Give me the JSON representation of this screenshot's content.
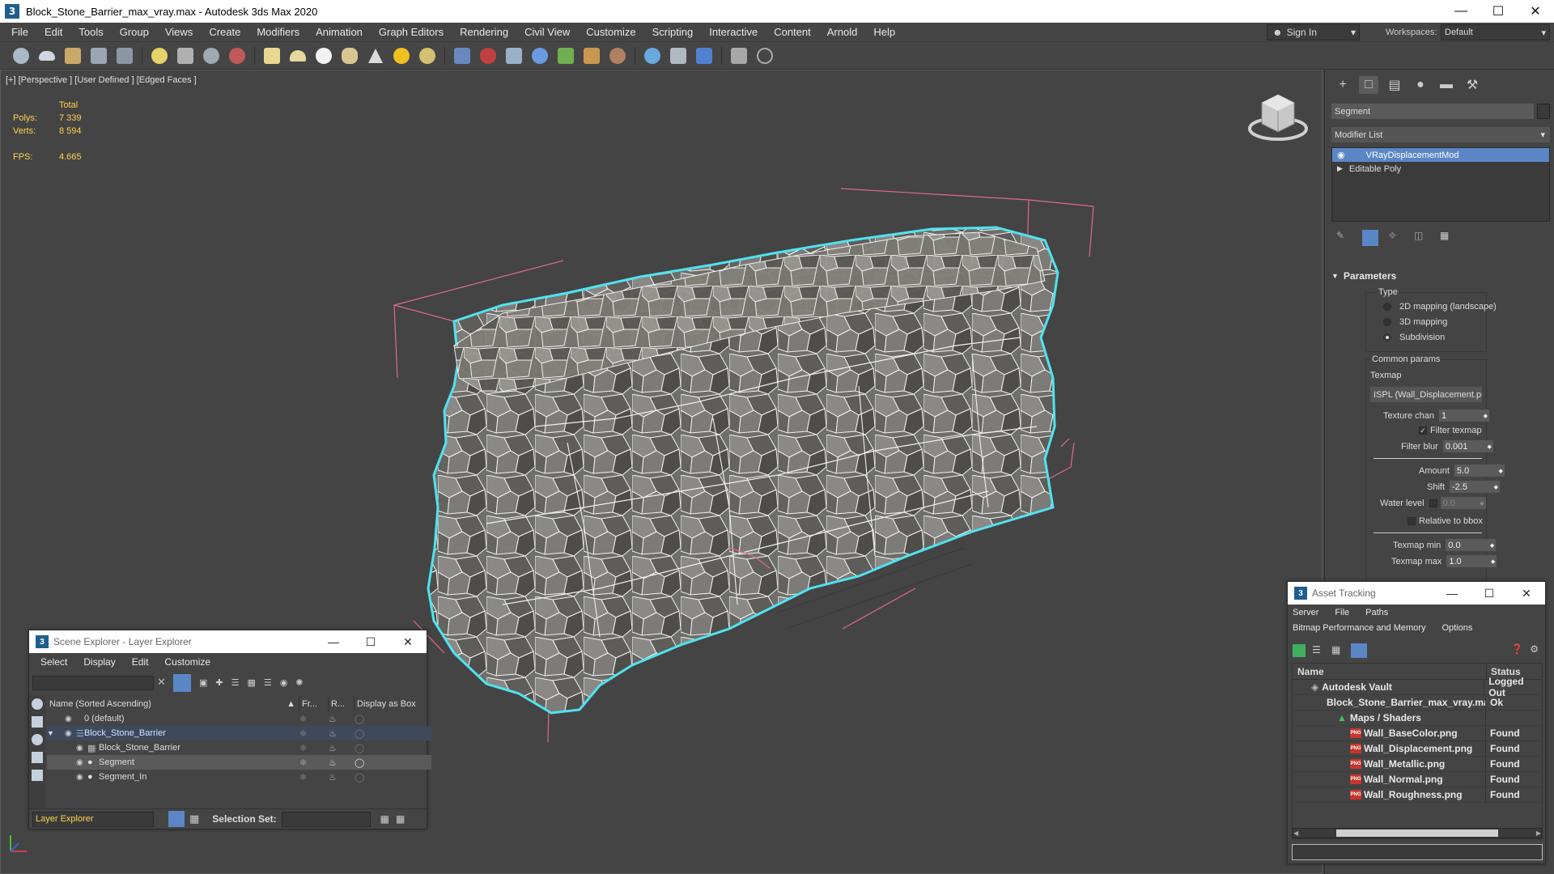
{
  "window": {
    "title": "Block_Stone_Barrier_max_vray.max - Autodesk 3ds Max 2020",
    "app_icon_glyph": "3",
    "minimize": "—",
    "maximize": "☐",
    "close": "✕"
  },
  "menu": [
    "File",
    "Edit",
    "Tools",
    "Group",
    "Views",
    "Create",
    "Modifiers",
    "Animation",
    "Graph Editors",
    "Rendering",
    "Civil View",
    "Customize",
    "Scripting",
    "Interactive",
    "Content",
    "Arnold",
    "Help"
  ],
  "signin": {
    "label": "Sign In",
    "arrow": "▾"
  },
  "workspace": {
    "label": "Workspaces:",
    "value": "Default",
    "arrow": "▾"
  },
  "viewport": {
    "label": "[+] [Perspective ] [User Defined ] [Edged Faces ]",
    "stats": {
      "header": "Total",
      "polys_label": "Polys:",
      "polys": "7 339",
      "verts_label": "Verts:",
      "verts": "8 594",
      "fps_label": "FPS:",
      "fps": "4.665"
    }
  },
  "command_panel": {
    "object_name": "Segment",
    "modifier_list": "Modifier List",
    "modifier_list_arrow": "▾",
    "stack": [
      "VRayDisplacementMod",
      "Editable Poly"
    ],
    "parameters": {
      "rollout": "Parameters",
      "type_label": "Type",
      "type_options": [
        "2D mapping (landscape)",
        "3D mapping",
        "Subdivision"
      ],
      "type_selected": "Subdivision",
      "common_label": "Common params",
      "texmap_label": "Texmap",
      "texmap_value": "ISPL (Wall_Displacement.png",
      "texture_chan_label": "Texture chan",
      "texture_chan": "1",
      "filter_texmap_label": "Filter texmap",
      "filter_blur_label": "Filter blur",
      "filter_blur": "0.001",
      "amount_label": "Amount",
      "amount": "5.0",
      "shift_label": "Shift",
      "shift": "-2.5",
      "water_label": "Water level",
      "water": "0.0",
      "relative_label": "Relative to bbox",
      "texmap_min_label": "Texmap min",
      "texmap_min": "0.0",
      "texmap_max_label": "Texmap max",
      "texmap_max": "1.0"
    }
  },
  "scene_explorer": {
    "title": "Scene Explorer - Layer Explorer",
    "menu": [
      "Select",
      "Display",
      "Edit",
      "Customize"
    ],
    "columns": {
      "name": "Name (Sorted Ascending)",
      "frozen": "Fr...",
      "render": "R...",
      "box": "Display as Box"
    },
    "rows": [
      {
        "name": "0 (default)",
        "indent": 0
      },
      {
        "name": "Block_Stone_Barrier",
        "indent": 0
      },
      {
        "name": "Block_Stone_Barrier",
        "indent": 1
      },
      {
        "name": "Segment",
        "indent": 1
      },
      {
        "name": "Segment_In",
        "indent": 1
      }
    ],
    "footer_explorer": "Layer Explorer",
    "selection_set_label": "Selection Set:"
  },
  "asset_tracking": {
    "title": "Asset Tracking",
    "menu1": [
      "Server",
      "File",
      "Paths"
    ],
    "menu2": [
      "Bitmap Performance and Memory",
      "Options"
    ],
    "columns": {
      "name": "Name",
      "status": "Status"
    },
    "rows": [
      {
        "name": "Autodesk Vault",
        "status": "Logged Out",
        "indent": 0,
        "icon": "vault"
      },
      {
        "name": "Block_Stone_Barrier_max_vray.max",
        "status": "Ok",
        "indent": 1,
        "icon": "max"
      },
      {
        "name": "Maps / Shaders",
        "status": "",
        "indent": 2,
        "icon": "maps"
      },
      {
        "name": "Wall_BaseColor.png",
        "status": "Found",
        "indent": 3,
        "icon": "png"
      },
      {
        "name": "Wall_Displacement.png",
        "status": "Found",
        "indent": 3,
        "icon": "png"
      },
      {
        "name": "Wall_Metallic.png",
        "status": "Found",
        "indent": 3,
        "icon": "png"
      },
      {
        "name": "Wall_Normal.png",
        "status": "Found",
        "indent": 3,
        "icon": "png"
      },
      {
        "name": "Wall_Roughness.png",
        "status": "Found",
        "indent": 3,
        "icon": "png"
      }
    ]
  },
  "colors": {
    "accent": "#5b86c6",
    "stats_yellow": "#ffd24d",
    "selection_outline": "#4fe3f0",
    "bbox": "#e06a8a"
  }
}
